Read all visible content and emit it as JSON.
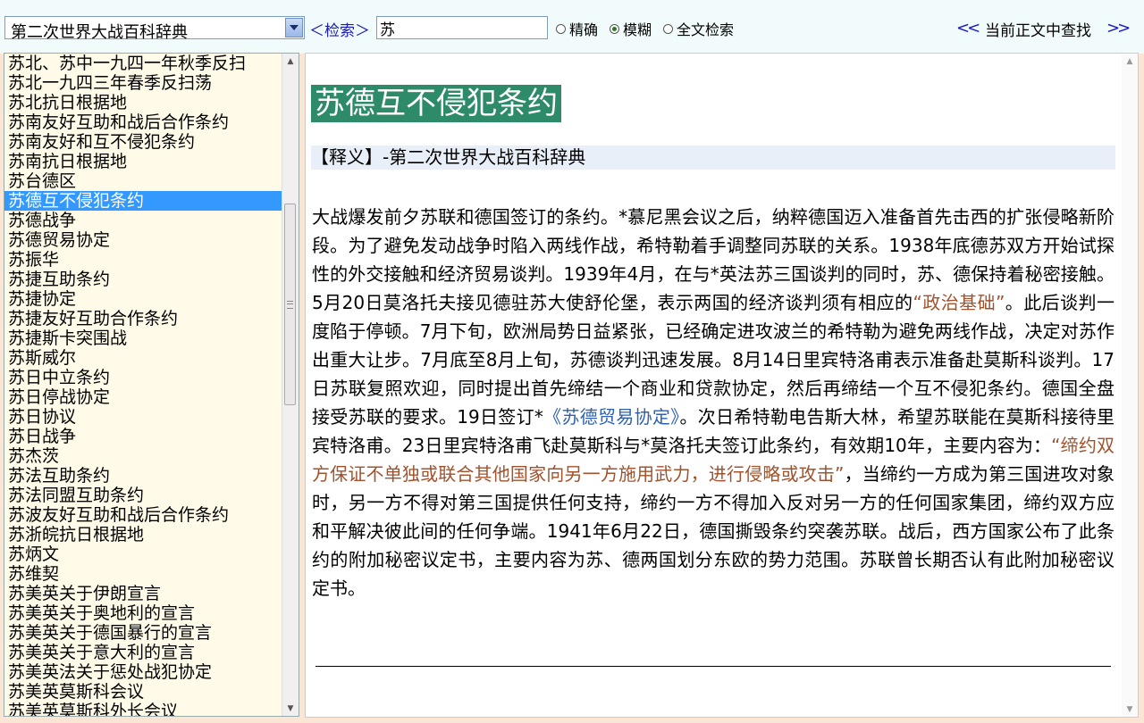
{
  "toolbar": {
    "dictionary_select": "第二次世界大战百科辞典",
    "search_label": "＜检索＞",
    "search_value": "苏",
    "radio_exact": "精确",
    "radio_fuzzy": "模糊",
    "radio_fulltext": "全文检索",
    "selected_mode": "模糊",
    "find_prev": "<<",
    "find_label": "当前正文中查找",
    "find_next": ">>"
  },
  "list": {
    "items": [
      "苏北、苏中一九四一年秋季反扫",
      "苏北一九四三年春季反扫荡",
      "苏北抗日根据地",
      "苏南友好互助和战后合作条约",
      "苏南友好和互不侵犯条约",
      "苏南抗日根据地",
      "苏台德区",
      "苏德互不侵犯条约",
      "苏德战争",
      "苏德贸易协定",
      "苏振华",
      "苏捷互助条约",
      "苏捷协定",
      "苏捷友好互助合作条约",
      "苏捷斯卡突围战",
      "苏斯威尔",
      "苏日中立条约",
      "苏日停战协定",
      "苏日协议",
      "苏日战争",
      "苏杰茨",
      "苏法互助条约",
      "苏法同盟互助条约",
      "苏波友好互助和战后合作条约",
      "苏浙皖抗日根据地",
      "苏炳文",
      "苏维契",
      "苏美英关于伊朗宣言",
      "苏美英关于奥地利的宣言",
      "苏美英关于德国暴行的宣言",
      "苏美英关于意大利的宣言",
      "苏美英法关于惩处战犯协定",
      "苏美英莫斯科会议",
      "苏美英莫斯科外长会议"
    ],
    "selected_index": 7
  },
  "article": {
    "title": "苏德互不侵犯条约",
    "sense": "【释义】-第二次世界大战百科辞典",
    "p1": "大战爆发前夕苏联和德国签订的条约。*慕尼黑会议之后，纳粹德国迈入准备首先击西的扩张侵略新阶段。为了避免发动战争时陷入两线作战，希特勒着手调整同苏联的关系。1938年底德苏双方开始试探性的外交接触和经济贸易谈判。1939年4月，在与*英法苏三国谈判的同时，苏、德保持着秘密接触。5月20日莫洛托夫接见德驻苏大使舒伦堡，表示两国的经济谈判须有相应的",
    "link1": "“政治基础”",
    "p2": "。此后谈判一度陷于停顿。7月下旬，欧洲局势日益紧张，已经确定进攻波兰的希特勒为避免两线作战，决定对苏作出重大让步。7月底至8月上旬，苏德谈判迅速发展。8月14日里宾特洛甫表示准备赴莫斯科谈判。17日苏联复照欢迎，同时提出首先缔结一个商业和贷款协定，然后再缔结一个互不侵犯条约。德国全盘接受苏联的要求。19日签订*",
    "link2": "《苏德贸易协定》",
    "p3": "。次日希特勒电告斯大林，希望苏联能在莫斯科接待里宾特洛甫。23日里宾特洛甫飞赴莫斯科与*莫洛托夫签订此条约，有效期10年，主要内容为：",
    "quote": "“缔约双方保证不单独或联合其他国家向另一方施用武力，进行侵略或攻击”",
    "p4": "，当缔约一方成为第三国进攻对象时，另一方不得对第三国提供任何支持，缔约一方不得加入反对另一方的任何国家集团，缔约双方应和平解决彼此间的任何争端。1941年6月22日，德国撕毁条约突袭苏联。战后，西方国家公布了此条约的附加秘密议定书，主要内容为苏、德两国划分东欧的势力范围。苏联曾长期否认有此附加秘密议定书。"
  },
  "icons": {
    "dropdown": "chevron-down-icon",
    "scroll_up": "scroll-up-arrow-icon",
    "scroll_down": "scroll-down-arrow-icon"
  },
  "colors": {
    "title_banner": "#2e8b6a",
    "selection": "#3399ff",
    "link_brown": "#a0522d",
    "link_blue": "#2e5fb0",
    "search_label": "#1a1ab8"
  }
}
